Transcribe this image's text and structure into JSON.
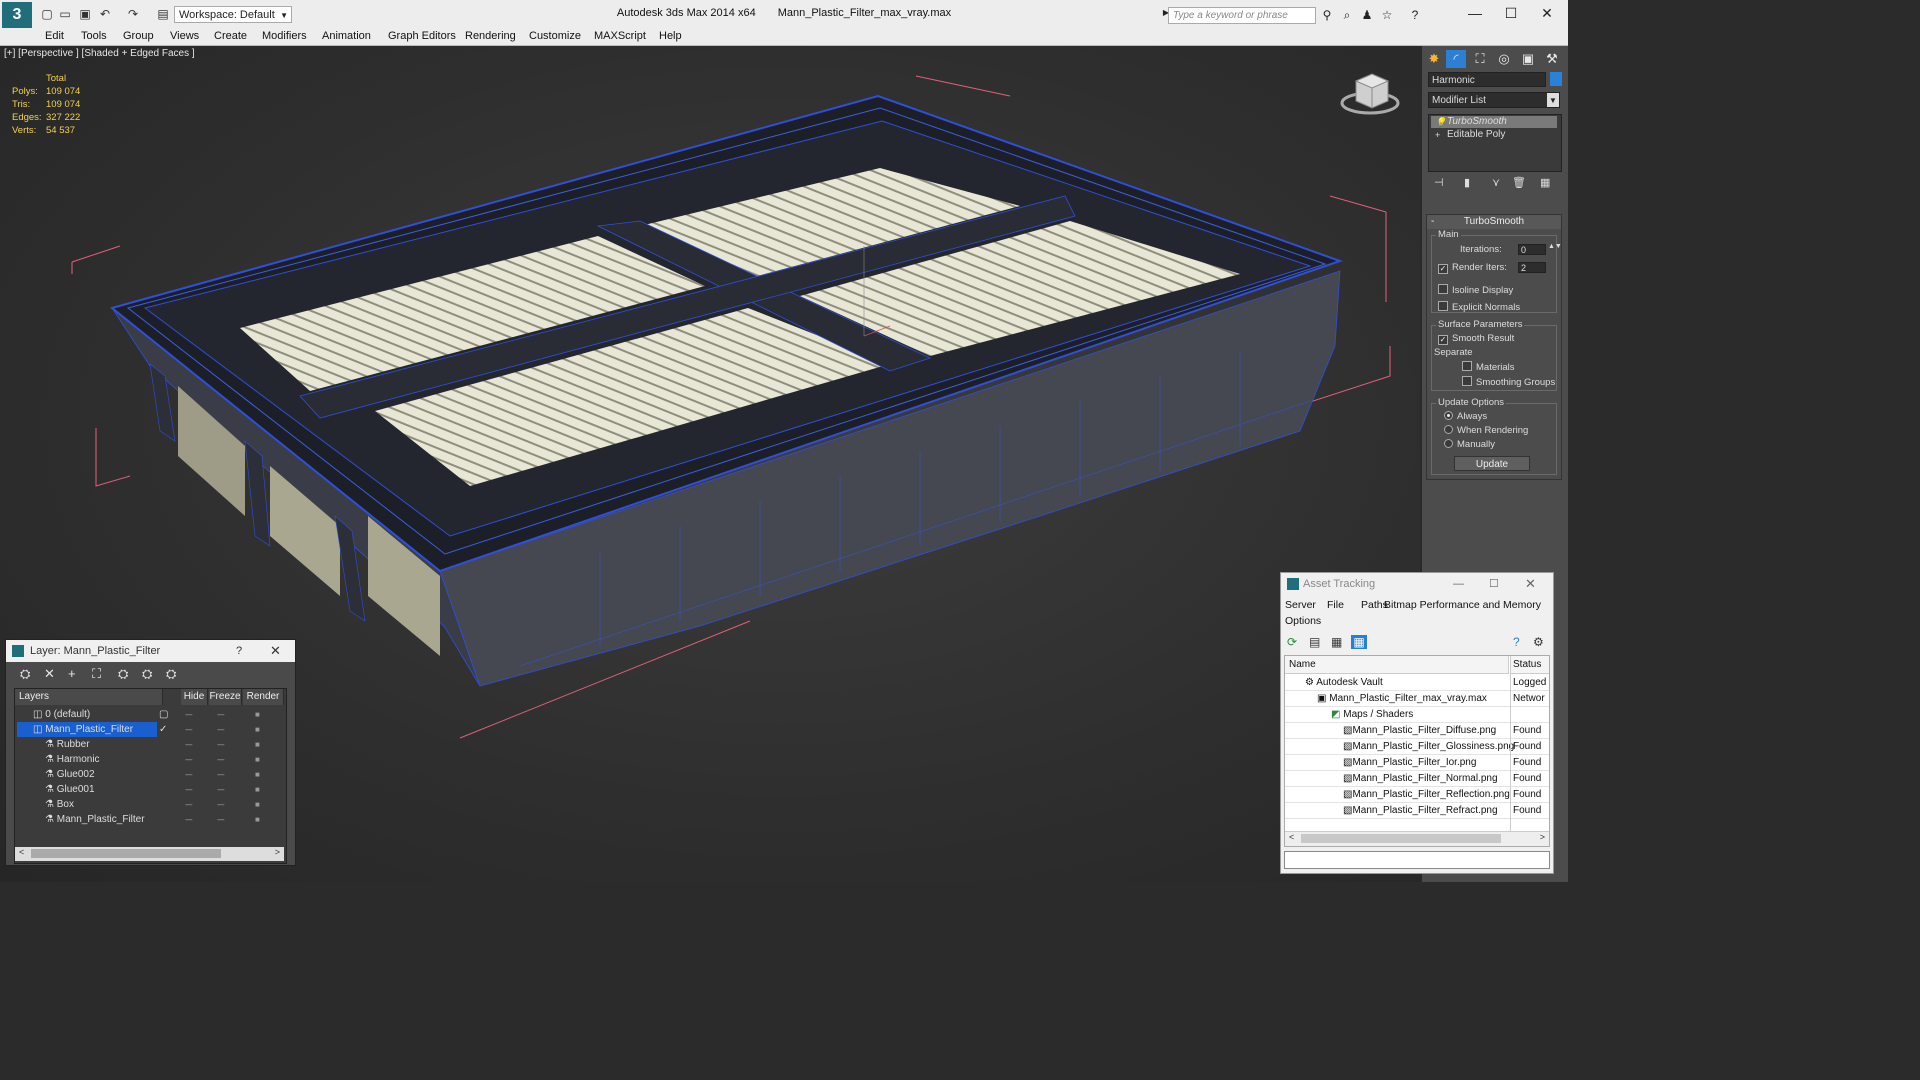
{
  "titlebar": {
    "app_title": "Autodesk 3ds Max  2014 x64",
    "file_title": "Mann_Plastic_Filter_max_vray.max",
    "workspace_label": "Workspace: Default",
    "search_placeholder": "Type a keyword or phrase"
  },
  "menu": [
    "Edit",
    "Tools",
    "Group",
    "Views",
    "Create",
    "Modifiers",
    "Animation",
    "Graph Editors",
    "Rendering",
    "Customize",
    "MAXScript",
    "Help"
  ],
  "viewport": {
    "label": "[+] [Perspective ] [Shaded + Edged Faces ]",
    "stats": {
      "total_label": "Total",
      "polys_label": "Polys:",
      "polys": "109 074",
      "tris_label": "Tris:",
      "tris": "109 074",
      "edges_label": "Edges:",
      "edges": "327 222",
      "verts_label": "Verts:",
      "verts": "54 537"
    }
  },
  "command_panel": {
    "object_name": "Harmonic",
    "object_color": "#2a82d8",
    "modifier_list": "Modifier List",
    "stack": [
      "TurboSmooth",
      "Editable Poly"
    ],
    "turbosmooth": {
      "title": "TurboSmooth",
      "main_label": "Main",
      "iterations_label": "Iterations:",
      "iterations": "0",
      "render_iters_label": "Render Iters:",
      "render_iters": "2",
      "isoline_label": "Isoline Display",
      "explicit_label": "Explicit Normals",
      "surface_label": "Surface Parameters",
      "smooth_label": "Smooth Result",
      "separate_label": "Separate",
      "materials_label": "Materials",
      "smoothing_groups_label": "Smoothing Groups",
      "update_options_label": "Update Options",
      "always_label": "Always",
      "when_rendering_label": "When Rendering",
      "manually_label": "Manually",
      "update_button": "Update"
    }
  },
  "layer_window": {
    "title": "Layer: Mann_Plastic_Filter",
    "help": "?",
    "columns": {
      "layers": "Layers",
      "hide": "Hide",
      "freeze": "Freeze",
      "render": "Render"
    },
    "rows": [
      {
        "name": "0 (default)",
        "indent": 0
      },
      {
        "name": "Mann_Plastic_Filter",
        "indent": 0,
        "selected": true
      },
      {
        "name": "Rubber",
        "indent": 1
      },
      {
        "name": "Harmonic",
        "indent": 1
      },
      {
        "name": "Glue002",
        "indent": 1
      },
      {
        "name": "Glue001",
        "indent": 1
      },
      {
        "name": "Box",
        "indent": 1
      },
      {
        "name": "Mann_Plastic_Filter",
        "indent": 1
      }
    ]
  },
  "asset_tracking": {
    "title": "Asset Tracking",
    "menu": [
      "Server",
      "File",
      "Paths",
      "Bitmap Performance and Memory",
      "Options"
    ],
    "columns": {
      "name": "Name",
      "status": "Status"
    },
    "rows": [
      {
        "name": "Autodesk Vault",
        "status": "Logged",
        "indent": 1
      },
      {
        "name": "Mann_Plastic_Filter_max_vray.max",
        "status": "Networ",
        "indent": 2
      },
      {
        "name": "Maps / Shaders",
        "status": "",
        "indent": 3
      },
      {
        "name": "Mann_Plastic_Filter_Diffuse.png",
        "status": "Found",
        "indent": 4
      },
      {
        "name": "Mann_Plastic_Filter_Glossiness.png",
        "status": "Found",
        "indent": 4
      },
      {
        "name": "Mann_Plastic_Filter_Ior.png",
        "status": "Found",
        "indent": 4
      },
      {
        "name": "Mann_Plastic_Filter_Normal.png",
        "status": "Found",
        "indent": 4
      },
      {
        "name": "Mann_Plastic_Filter_Reflection.png",
        "status": "Found",
        "indent": 4
      },
      {
        "name": "Mann_Plastic_Filter_Refract.png",
        "status": "Found",
        "indent": 4
      }
    ]
  },
  "colors": {
    "stats": "#f4d24a",
    "wire": "#2f4fd8",
    "selection": "#1a5fd0",
    "bbox": "#e0607a"
  }
}
